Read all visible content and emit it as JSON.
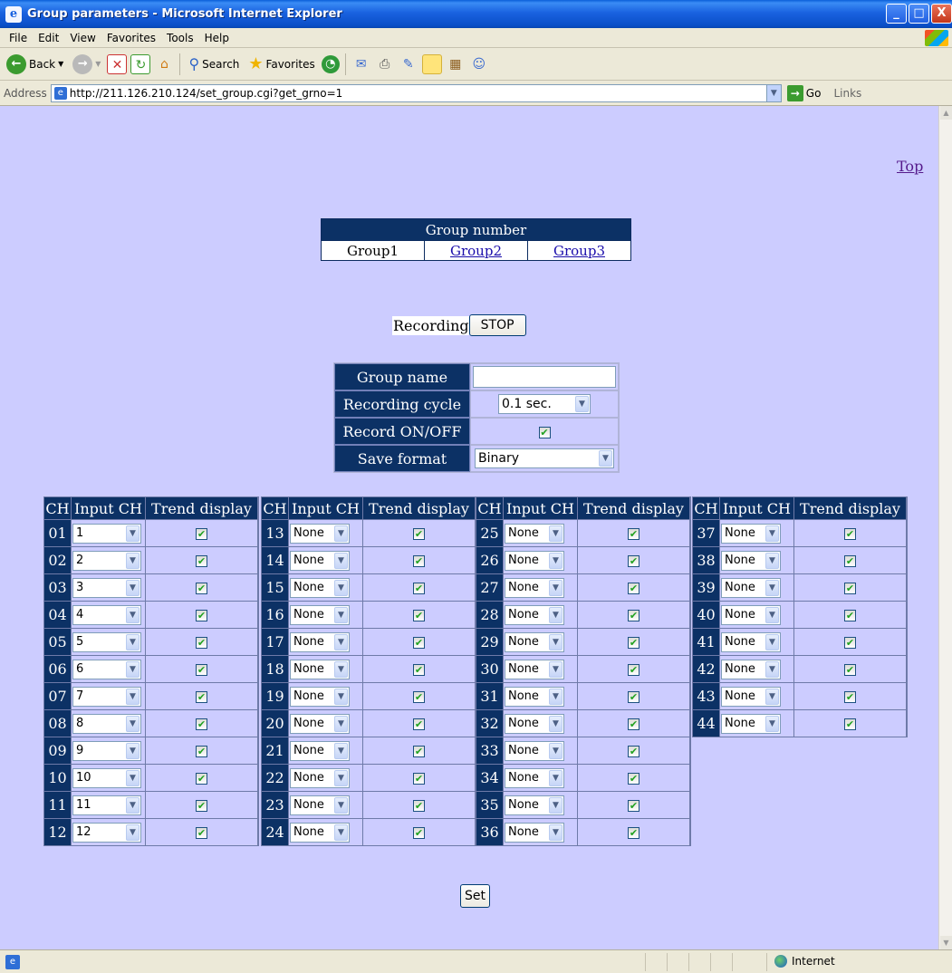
{
  "window": {
    "title": "Group parameters - Microsoft Internet Explorer",
    "min_glyph": "_",
    "max_glyph": "□",
    "close_glyph": "X"
  },
  "menu": [
    "File",
    "Edit",
    "View",
    "Favorites",
    "Tools",
    "Help"
  ],
  "toolbar": {
    "back": "Back",
    "search": "Search",
    "favorites": "Favorites"
  },
  "address": {
    "label": "Address",
    "url": "http://211.126.210.124/set_group.cgi?get_grno=1",
    "go": "Go",
    "links": "Links"
  },
  "page": {
    "top_link": "Top",
    "group_table": {
      "header": "Group number",
      "groups": [
        "Group1",
        "Group2",
        "Group3"
      ],
      "current": "Group1"
    },
    "recording": {
      "label": "Recording",
      "button": "STOP"
    },
    "settings": {
      "group_name_label": "Group name",
      "group_name_value": "",
      "cycle_label": "Recording cycle",
      "cycle_value": "0.1 sec.",
      "record_label": "Record ON/OFF",
      "record_checked": true,
      "format_label": "Save format",
      "format_value": "Binary"
    },
    "channel_headers": {
      "ch": "CH",
      "input": "Input CH",
      "trend": "Trend display"
    },
    "channel_tables": [
      {
        "rows": [
          {
            "ch": "01",
            "input": "1"
          },
          {
            "ch": "02",
            "input": "2"
          },
          {
            "ch": "03",
            "input": "3"
          },
          {
            "ch": "04",
            "input": "4"
          },
          {
            "ch": "05",
            "input": "5"
          },
          {
            "ch": "06",
            "input": "6"
          },
          {
            "ch": "07",
            "input": "7"
          },
          {
            "ch": "08",
            "input": "8"
          },
          {
            "ch": "09",
            "input": "9"
          },
          {
            "ch": "10",
            "input": "10"
          },
          {
            "ch": "11",
            "input": "11"
          },
          {
            "ch": "12",
            "input": "12"
          }
        ]
      },
      {
        "rows": [
          {
            "ch": "13",
            "input": "None"
          },
          {
            "ch": "14",
            "input": "None"
          },
          {
            "ch": "15",
            "input": "None"
          },
          {
            "ch": "16",
            "input": "None"
          },
          {
            "ch": "17",
            "input": "None"
          },
          {
            "ch": "18",
            "input": "None"
          },
          {
            "ch": "19",
            "input": "None"
          },
          {
            "ch": "20",
            "input": "None"
          },
          {
            "ch": "21",
            "input": "None"
          },
          {
            "ch": "22",
            "input": "None"
          },
          {
            "ch": "23",
            "input": "None"
          },
          {
            "ch": "24",
            "input": "None"
          }
        ]
      },
      {
        "rows": [
          {
            "ch": "25",
            "input": "None"
          },
          {
            "ch": "26",
            "input": "None"
          },
          {
            "ch": "27",
            "input": "None"
          },
          {
            "ch": "28",
            "input": "None"
          },
          {
            "ch": "29",
            "input": "None"
          },
          {
            "ch": "30",
            "input": "None"
          },
          {
            "ch": "31",
            "input": "None"
          },
          {
            "ch": "32",
            "input": "None"
          },
          {
            "ch": "33",
            "input": "None"
          },
          {
            "ch": "34",
            "input": "None"
          },
          {
            "ch": "35",
            "input": "None"
          },
          {
            "ch": "36",
            "input": "None"
          }
        ]
      },
      {
        "rows": [
          {
            "ch": "37",
            "input": "None"
          },
          {
            "ch": "38",
            "input": "None"
          },
          {
            "ch": "39",
            "input": "None"
          },
          {
            "ch": "40",
            "input": "None"
          },
          {
            "ch": "41",
            "input": "None"
          },
          {
            "ch": "42",
            "input": "None"
          },
          {
            "ch": "43",
            "input": "None"
          },
          {
            "ch": "44",
            "input": "None"
          }
        ]
      }
    ],
    "set_button": "Set"
  },
  "status": {
    "zone": "Internet"
  },
  "colors": {
    "page_bg": "#ccccff",
    "header_bg": "#0c3165",
    "link": "#1a0dab"
  }
}
